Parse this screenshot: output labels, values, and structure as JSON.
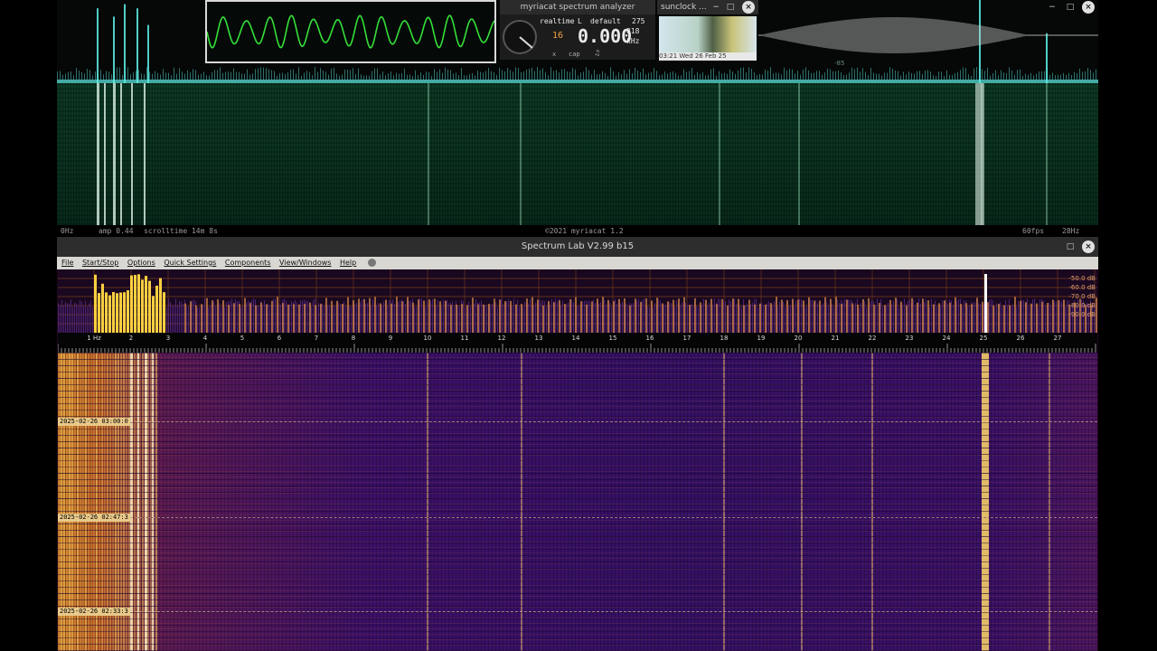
{
  "myriacat": {
    "title": "myriacat spectrum analyzer",
    "meter": {
      "mode": "realtime",
      "channel": "L",
      "preset": "default",
      "counter": "275",
      "frequency": "0.000",
      "sub_value": "818",
      "unit": "kHz",
      "bits": "16",
      "cap_label": "cap",
      "x_label": "x"
    },
    "status": {
      "left_freq": "0Hz",
      "amp": "amp 0.44",
      "scrolltime": "scrolltime 14m 8s",
      "copyright": "©2021 myriacat 1.2",
      "fps": "60fps",
      "right_freq": "28Hz"
    },
    "spectrum_label": "-85"
  },
  "sunclock": {
    "title": "sunclock ...",
    "time": "03:21 Wed 26 Feb 25"
  },
  "spectrumlab": {
    "title": "Spectrum Lab V2.99 b15",
    "menu": [
      "File",
      "Start/Stop",
      "Options",
      "Quick Settings",
      "Components",
      "View/Windows",
      "Help"
    ],
    "db_labels": [
      "-50.0 dB",
      "-60.0 dB",
      "-70.0 dB",
      "-80.0 dB",
      "-90.0 dB"
    ],
    "freq_labels": [
      "1 Hz",
      "2",
      "3",
      "4",
      "5",
      "6",
      "7",
      "8",
      "9",
      "10",
      "11",
      "12",
      "13",
      "14",
      "15",
      "16",
      "17",
      "18",
      "19",
      "20",
      "21",
      "22",
      "23",
      "24",
      "25",
      "26",
      "27"
    ],
    "timestamps": [
      "2025-02-26 03:00:0",
      "2025-02-26 02:47:3",
      "2025-02-26 02:33:3"
    ]
  },
  "colors": {
    "myriacat_trace": "#5ff0e8",
    "scope_trace": "#35e038",
    "spectrum_bar": "#d98a4a",
    "spectrum_bar_hot": "#ffd040",
    "waterfall_hot": "#ffd86a",
    "grid": "#8a4a1a"
  }
}
